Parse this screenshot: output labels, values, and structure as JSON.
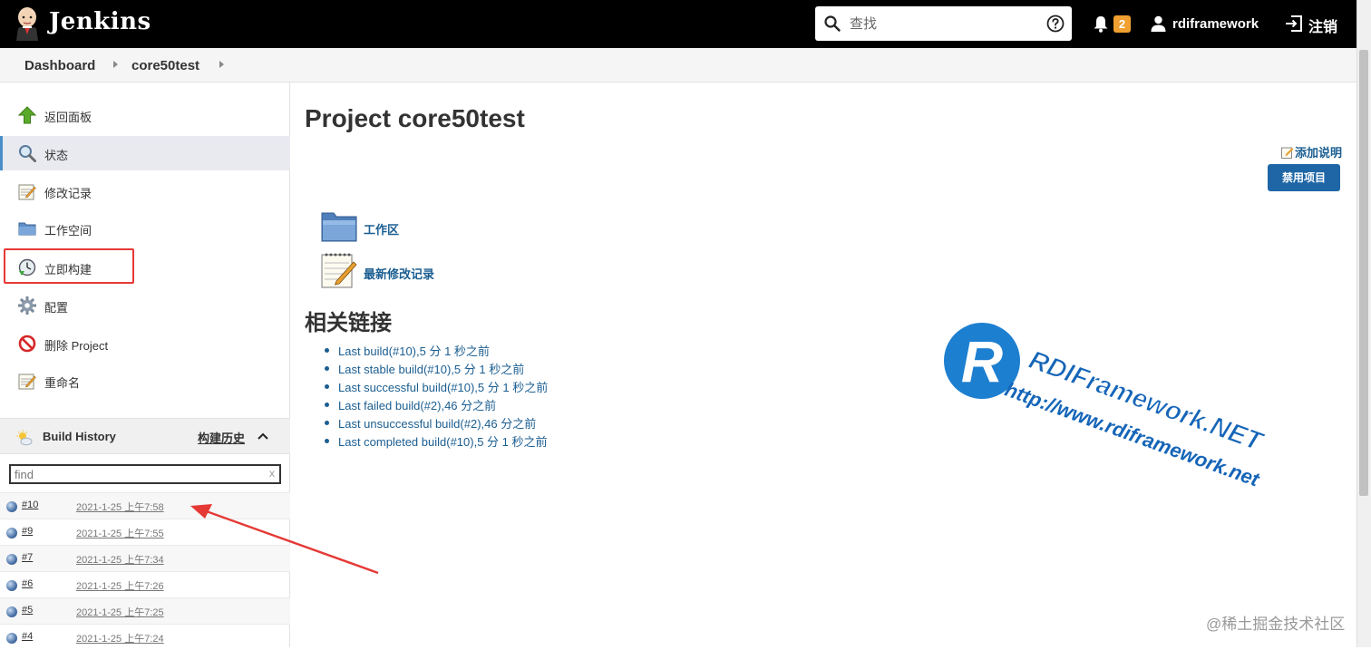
{
  "header": {
    "brand": "Jenkins",
    "search_placeholder": "查找",
    "notification_count": "2",
    "username": "rdiframework",
    "logout_label": "注销",
    "colors": {
      "bar": "#000000",
      "badge": "#f0a030"
    }
  },
  "breadcrumbs": [
    "Dashboard",
    "core50test"
  ],
  "sidebar": {
    "tasks": [
      {
        "label": "返回面板",
        "icon": "arrow-up-icon"
      },
      {
        "label": "状态",
        "icon": "search-icon"
      },
      {
        "label": "修改记录",
        "icon": "notepad-icon"
      },
      {
        "label": "工作空间",
        "icon": "folder-icon"
      },
      {
        "label": "立即构建",
        "icon": "clock-icon"
      },
      {
        "label": "配置",
        "icon": "gear-icon"
      },
      {
        "label": "删除 Project",
        "icon": "no-entry-icon"
      },
      {
        "label": "重命名",
        "icon": "notepad-icon"
      }
    ]
  },
  "build_history": {
    "title": "Build History",
    "title_cn": "构建历史",
    "filter_placeholder": "find",
    "clear_label": "x",
    "builds": [
      {
        "number": "#10",
        "date": "2021-1-25 上午7:58"
      },
      {
        "number": "#9",
        "date": "2021-1-25 上午7:55"
      },
      {
        "number": "#7",
        "date": "2021-1-25 上午7:34"
      },
      {
        "number": "#6",
        "date": "2021-1-25 上午7:26"
      },
      {
        "number": "#5",
        "date": "2021-1-25 上午7:25"
      },
      {
        "number": "#4",
        "date": "2021-1-25 上午7:24"
      }
    ]
  },
  "main": {
    "title": "Project core50test",
    "add_description": "添加说明",
    "disable_button": "禁用项目",
    "project_links": [
      "工作区",
      "最新修改记录"
    ],
    "related_title": "相关链接",
    "related_links": [
      "Last build(#10),5 分 1 秒之前",
      "Last stable build(#10),5 分 1 秒之前",
      "Last successful build(#10),5 分 1 秒之前",
      "Last failed build(#2),46 分之前",
      "Last unsuccessful build(#2),46 分之前",
      "Last completed build(#10),5 分 1 秒之前"
    ]
  },
  "watermark": {
    "letter": "R",
    "line1": "RDIFramework.NET",
    "line2": "http://www.rdiframework.net"
  },
  "footer_watermark": "@稀土掘金技术社区"
}
